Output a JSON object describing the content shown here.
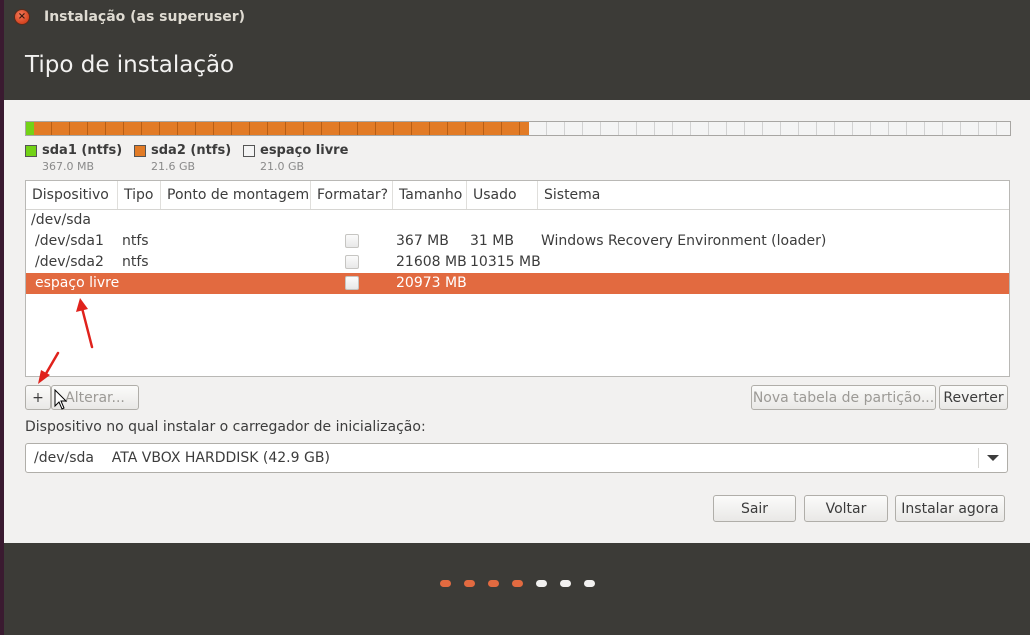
{
  "window": {
    "title": "Instalação (as superuser)",
    "heading": "Tipo de instalação"
  },
  "disk_bar": {
    "segments": [
      {
        "name": "sda1 (ntfs)",
        "size": "367.0 MB",
        "size_mb": 367,
        "color": "#73d216"
      },
      {
        "name": "sda2 (ntfs)",
        "size": "21.6 GB",
        "size_mb": 21608,
        "color": "#e27b26"
      },
      {
        "name": "espaço livre",
        "size": "21.0 GB",
        "size_mb": 20973,
        "color": "#f4f4f4"
      }
    ]
  },
  "table": {
    "columns": [
      "Dispositivo",
      "Tipo",
      "Ponto de montagem",
      "Formatar?",
      "Tamanho",
      "Usado",
      "Sistema"
    ],
    "disk": "/dev/sda",
    "rows": [
      {
        "device": "/dev/sda1",
        "type": "ntfs",
        "mount": "",
        "format": false,
        "size": "367 MB",
        "used": "31 MB",
        "system": "Windows Recovery Environment (loader)",
        "selected": false
      },
      {
        "device": "/dev/sda2",
        "type": "ntfs",
        "mount": "",
        "format": false,
        "size": "21608 MB",
        "used": "10315 MB",
        "system": "",
        "selected": false
      },
      {
        "device": "espaço livre",
        "type": "",
        "mount": "",
        "format": false,
        "size": "20973 MB",
        "used": "",
        "system": "",
        "selected": true
      }
    ]
  },
  "toolbar": {
    "add_label": "+",
    "change_label": "Alterar...",
    "new_table_label": "Nova tabela de partição...",
    "revert_label": "Reverter"
  },
  "bootloader": {
    "label": "Dispositivo no qual instalar o carregador de inicialização:",
    "selected": "/dev/sda    ATA VBOX HARDDISK (42.9 GB)"
  },
  "actions": {
    "quit_label": "Sair",
    "back_label": "Voltar",
    "install_label": "Instalar agora"
  },
  "progress": {
    "total_steps": 7,
    "completed_steps": 4,
    "active_color": "#e26a40",
    "inactive_color": "#f2f1f0"
  },
  "colors": {
    "accent": "#e26a40",
    "titlebar": "#3c3b37",
    "annotation_arrow": "#e0221c"
  }
}
